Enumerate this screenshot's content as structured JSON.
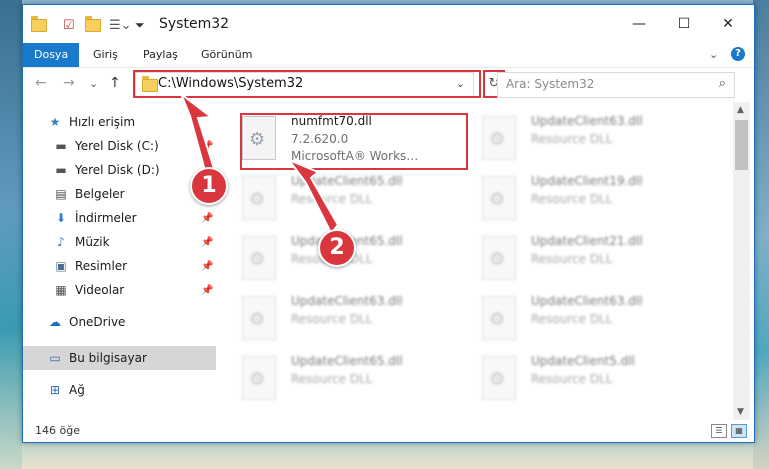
{
  "window": {
    "title": "System32",
    "controls": {
      "minimize": "—",
      "maximize": "☐",
      "close": "✕"
    }
  },
  "ribbon": {
    "tabs": [
      {
        "label": "Dosya",
        "active": true
      },
      {
        "label": "Giriş"
      },
      {
        "label": "Paylaş"
      },
      {
        "label": "Görünüm"
      }
    ],
    "help": "?",
    "collapse": "⌄"
  },
  "nav": {
    "back": "←",
    "forward": "→",
    "recent": "⌄",
    "up": "↑"
  },
  "address": {
    "path": "C:\\Windows\\System32",
    "dropdown": "⌄",
    "refresh": "↻"
  },
  "search": {
    "placeholder": "Ara: System32",
    "icon": "⌕"
  },
  "sidebar": {
    "items": [
      {
        "label": "Hızlı erişim",
        "icon": "star-icon",
        "glyph": "★"
      },
      {
        "label": "Yerel Disk (C:)",
        "icon": "drive-icon",
        "glyph": "▬",
        "pinned": true
      },
      {
        "label": "Yerel Disk (D:)",
        "icon": "drive-icon",
        "glyph": "▬",
        "pinned": true
      },
      {
        "label": "Belgeler",
        "icon": "documents-icon",
        "glyph": "▤",
        "pinned": true
      },
      {
        "label": "İndirmeler",
        "icon": "download-icon",
        "glyph": "⬇",
        "pinned": true
      },
      {
        "label": "Müzik",
        "icon": "music-icon",
        "glyph": "♪",
        "pinned": true
      },
      {
        "label": "Resimler",
        "icon": "pictures-icon",
        "glyph": "▣",
        "pinned": true
      },
      {
        "label": "Videolar",
        "icon": "video-icon",
        "glyph": "▦",
        "pinned": true
      },
      {
        "label": "OneDrive",
        "icon": "cloud-icon",
        "glyph": "☁"
      },
      {
        "label": "Bu bilgisayar",
        "icon": "computer-icon",
        "glyph": "▭",
        "selected": true
      },
      {
        "label": "Ağ",
        "icon": "network-icon",
        "glyph": "⊞"
      }
    ]
  },
  "files": [
    {
      "name": "numfmt70.dll",
      "line2": "7.2.620.0",
      "line3": "MicrosoftA® Works…",
      "highlighted": true
    },
    {
      "name": "UpdateClient63.dll",
      "line2": "Resource DLL"
    },
    {
      "name": "UpdateClient65.dll",
      "line2": "Resource DLL"
    },
    {
      "name": "UpdateClient19.dll",
      "line2": "Resource DLL"
    },
    {
      "name": "UpdateClient65.dll",
      "line2": "Resource DLL"
    },
    {
      "name": "UpdateClient21.dll",
      "line2": "Resource DLL"
    },
    {
      "name": "UpdateClient63.dll",
      "line2": "Resource DLL"
    },
    {
      "name": "UpdateClient63.dll",
      "line2": "Resource DLL"
    },
    {
      "name": "UpdateClient65.dll",
      "line2": "Resource DLL"
    },
    {
      "name": "UpdateClient5.dll",
      "line2": "Resource DLL"
    }
  ],
  "status": {
    "count": "146 öğe"
  },
  "callouts": {
    "one": "1",
    "two": "2"
  },
  "colors": {
    "accent": "#1979ca",
    "highlight": "#d9363e"
  }
}
